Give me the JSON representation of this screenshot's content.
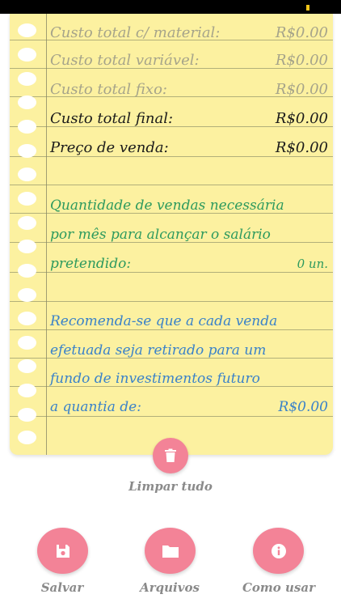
{
  "rows": [
    {
      "label": "Custo total c/ material:",
      "value": "R$0.00"
    },
    {
      "label": "Custo total variável:",
      "value": "R$0.00"
    },
    {
      "label": "Custo total fixo:",
      "value": "R$0.00"
    },
    {
      "label": "Custo total final:",
      "value": "R$0.00"
    },
    {
      "label": "Preço de venda:",
      "value": "R$0.00"
    }
  ],
  "quantity": {
    "line1": "Quantidade de vendas necessária",
    "line2": "por mês para alcançar o salário",
    "line3": "pretendido:",
    "value": "0 un."
  },
  "recommendation": {
    "line1": "Recomenda-se que a cada venda",
    "line2": "efetuada seja retirado para um",
    "line3": "fundo de investimentos futuro",
    "line4": "a quantia de:",
    "value": "R$0.00"
  },
  "actions": {
    "clear_label": "Limpar tudo",
    "save_label": "Salvar",
    "files_label": "Arquivos",
    "help_label": "Como usar"
  },
  "colors": {
    "paper": "#fcf1a0",
    "button": "#f38397",
    "quantity_text": "#2d9a5e",
    "recommendation_text": "#3a82c9"
  },
  "icons": {
    "clear": "trash-icon",
    "save": "floppy-disk-icon",
    "files": "folder-icon",
    "help": "info-icon"
  }
}
